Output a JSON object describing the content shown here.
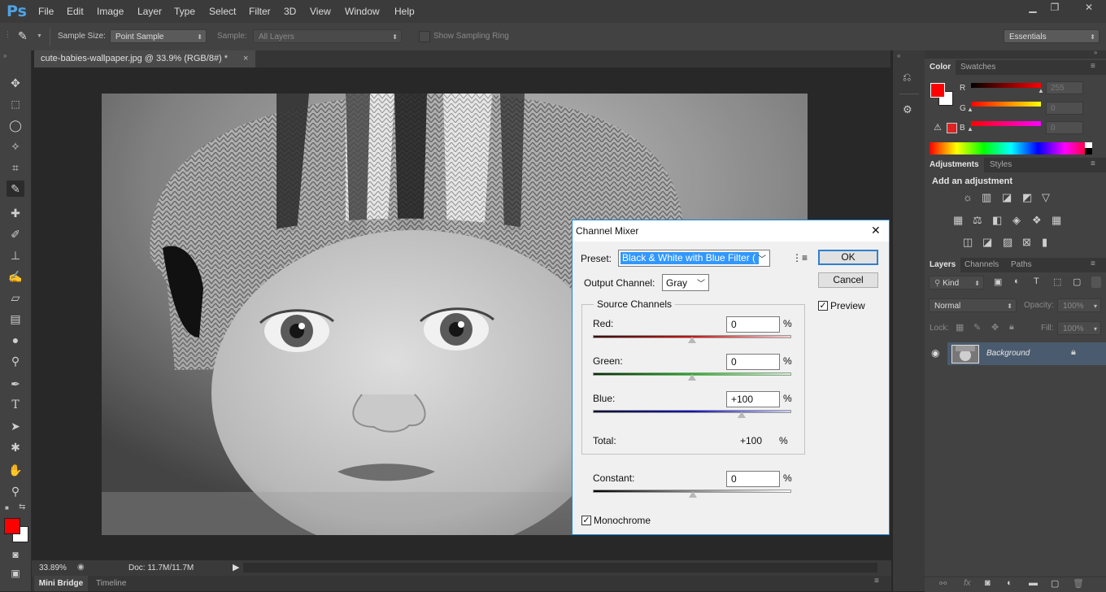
{
  "app": {
    "logo": "Ps"
  },
  "menu": [
    "File",
    "Edit",
    "Image",
    "Layer",
    "Type",
    "Select",
    "Filter",
    "3D",
    "View",
    "Window",
    "Help"
  ],
  "window_controls": {
    "minimize": "▁",
    "restore": "❐",
    "close": "✕"
  },
  "options_bar": {
    "sample_size_label": "Sample Size:",
    "sample_size_value": "Point Sample",
    "sample_label": "Sample:",
    "sample_value": "All Layers",
    "show_ring_label": "Show Sampling Ring",
    "workspace": "Essentials"
  },
  "document": {
    "tab_title": "cute-babies-wallpaper.jpg @ 33.9% (RGB/8#) *",
    "close": "×",
    "zoom": "33.89%",
    "doc_size": "Doc: 11.7M/11.7M"
  },
  "bottom_tabs": [
    "Mini Bridge",
    "Timeline"
  ],
  "color_panel": {
    "tabs": [
      "Color",
      "Swatches"
    ],
    "channels": [
      {
        "label": "R",
        "value": "255"
      },
      {
        "label": "G",
        "value": "0"
      },
      {
        "label": "B",
        "value": "0"
      }
    ],
    "foreground": "#ff0000",
    "background": "#ffffff"
  },
  "adjustments_panel": {
    "tabs": [
      "Adjustments",
      "Styles"
    ],
    "heading": "Add an adjustment"
  },
  "layers_panel": {
    "tabs": [
      "Layers",
      "Channels",
      "Paths"
    ],
    "filter": "Kind",
    "blend_mode": "Normal",
    "opacity_label": "Opacity:",
    "opacity_value": "100%",
    "lock_label": "Lock:",
    "fill_label": "Fill:",
    "fill_value": "100%",
    "layers": [
      {
        "name": "Background",
        "visible": true,
        "locked": true
      }
    ]
  },
  "dialog": {
    "title": "Channel Mixer",
    "close": "✕",
    "preset_label": "Preset:",
    "preset_value": "Black & White with Blue Filter (",
    "output_label": "Output Channel:",
    "output_value": "Gray",
    "group_title": "Source Channels",
    "channels": [
      {
        "label": "Red:",
        "value": "0",
        "percent": "%",
        "level": 0
      },
      {
        "label": "Green:",
        "value": "0",
        "percent": "%",
        "level": 0
      },
      {
        "label": "Blue:",
        "value": "+100",
        "percent": "%",
        "level": 100
      }
    ],
    "total_label": "Total:",
    "total_value": "+100",
    "total_percent": "%",
    "constant_label": "Constant:",
    "constant_value": "0",
    "constant_percent": "%",
    "monochrome_label": "Monochrome",
    "monochrome_checked": true,
    "ok": "OK",
    "cancel": "Cancel",
    "preview_label": "Preview",
    "preview_checked": true
  }
}
